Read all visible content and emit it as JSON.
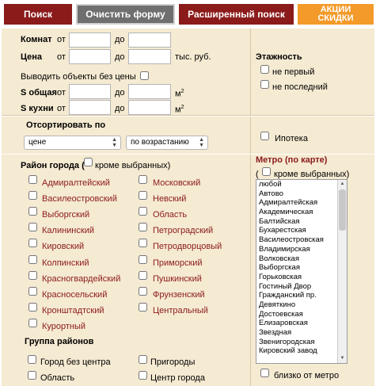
{
  "topbar": {
    "search": "Поиск",
    "clear": "Очистить форму",
    "advanced": "Расширенный поиск",
    "promo_line1": "АКЦИИ",
    "promo_line2": "СКИДКИ"
  },
  "params": {
    "rooms_label": "Комнат",
    "price_label": "Цена",
    "from": "от",
    "to": "до",
    "price_unit": "тыс. руб.",
    "no_price_label": "Выводить объекты без цены",
    "total_area_label": "S общая",
    "kitchen_area_label": "S кухни",
    "area_unit": "м",
    "area_sup": "2"
  },
  "floor": {
    "title": "Этажность",
    "not_first": "не первый",
    "not_last": "не последний"
  },
  "sort": {
    "title": "Отсортировать по",
    "field_selected": "цене",
    "order_selected": "по возрастанию",
    "mortgage": "Ипотека"
  },
  "districts": {
    "title": "Район города (",
    "except": "кроме выбранных)",
    "left": [
      "Адмиралтейский",
      "Василеостровский",
      "Выборгский",
      "Калининский",
      "Кировский",
      "Колпинский",
      "Красногвардейский",
      "Красносельский",
      "Кронштадтский",
      "Курортный"
    ],
    "right": [
      "Московский",
      "Невский",
      "Область",
      "Петроградский",
      "Петродворцовый",
      "Приморский",
      "Пушкинский",
      "Фрунзенский",
      "Центральный"
    ],
    "group_title": "Группа районов",
    "groups": [
      "Город без центра",
      "Пригороды",
      "Область",
      "Центр города"
    ]
  },
  "metro": {
    "title": "Метро (по карте)",
    "except_open": "(",
    "except": "кроме выбранных)",
    "stations": [
      "любой",
      "Автово",
      "Адмиралтейская",
      "Академическая",
      "Балтийская",
      "Бухарестская",
      "Василеостровская",
      "Владимирская",
      "Волковская",
      "Выборгская",
      "Горьковская",
      "Гостиный Двор",
      "Гражданский пр.",
      "Девяткино",
      "Достоевская",
      "Елизаровская",
      "Звездная",
      "Звенигородская",
      "Кировский завод"
    ],
    "near": "близко от метро"
  }
}
